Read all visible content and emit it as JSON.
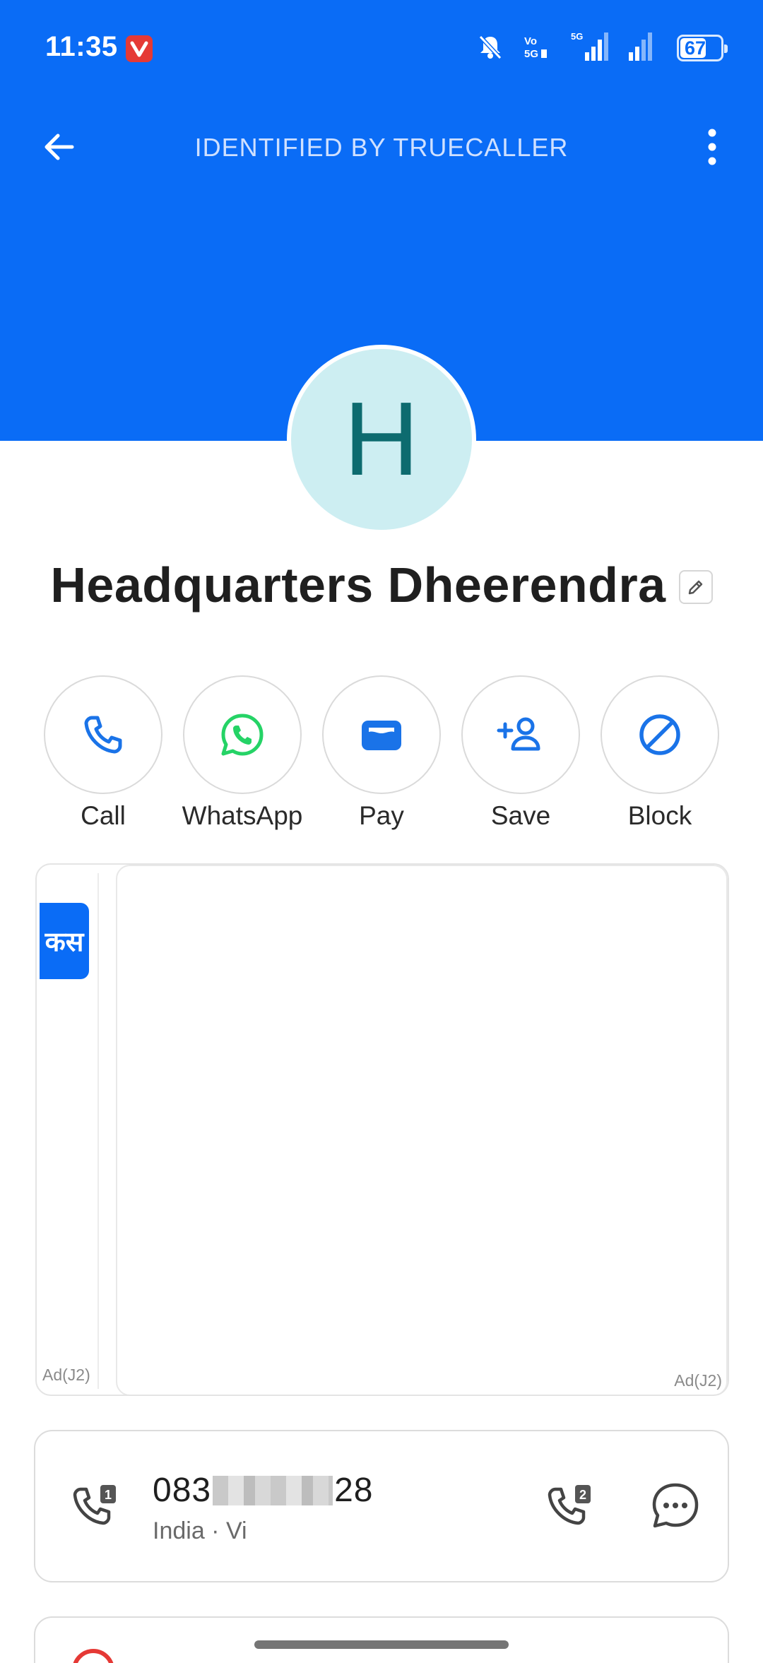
{
  "status_bar": {
    "time": "11:35",
    "battery_level": "67",
    "icons": [
      "vivaldi-app-icon",
      "bell-off-icon",
      "volte-icon",
      "signal-5g-icon",
      "signal-icon",
      "battery-icon"
    ]
  },
  "toolbar": {
    "title": "IDENTIFIED BY TRUECALLER"
  },
  "contact": {
    "avatar_letter": "H",
    "name": "Headquarters Dheerendra"
  },
  "actions": [
    {
      "label": "Call",
      "icon": "phone-icon"
    },
    {
      "label": "WhatsApp",
      "icon": "whatsapp-icon"
    },
    {
      "label": "Pay",
      "icon": "wallet-icon"
    },
    {
      "label": "Save",
      "icon": "add-contact-icon"
    },
    {
      "label": "Block",
      "icon": "block-icon"
    }
  ],
  "ads": {
    "left_chip_text": "कस",
    "left_tag": "Ad(J2)",
    "right_tag": "Ad(J2)"
  },
  "number_card": {
    "number_prefix": "083",
    "number_suffix": "28",
    "meta": "India · Vi"
  },
  "colors": {
    "header_blue": "#0a6cf6",
    "action_blue": "#1a73e8",
    "whatsapp_green": "#25d366",
    "avatar_bg": "#cdeef2",
    "avatar_text": "#0d6b6f"
  }
}
